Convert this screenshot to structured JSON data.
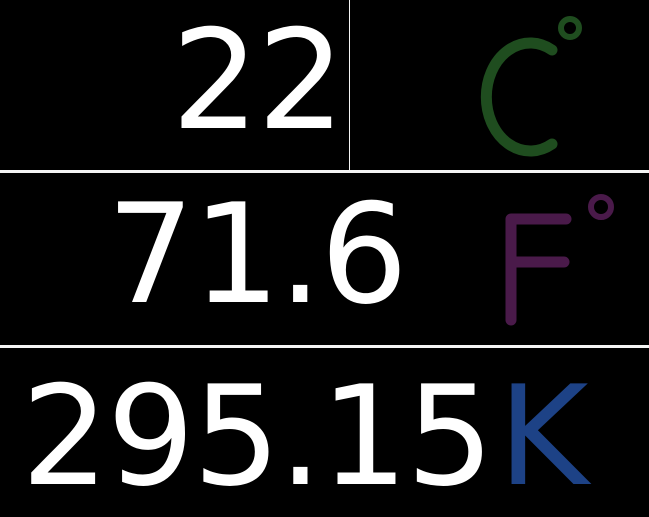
{
  "readings": [
    {
      "value": "22",
      "unit": "C",
      "unit_icon": "degree-celsius-icon",
      "color": "#1f4d1f"
    },
    {
      "value": "71.6",
      "unit": "F",
      "unit_icon": "degree-fahrenheit-icon",
      "color": "#4a1a4a"
    },
    {
      "value": "295.15",
      "unit": "K",
      "color": "#1d4286"
    }
  ],
  "theme": {
    "background": "#000000",
    "text": "#ffffff",
    "divider": "#f4f4f4"
  }
}
